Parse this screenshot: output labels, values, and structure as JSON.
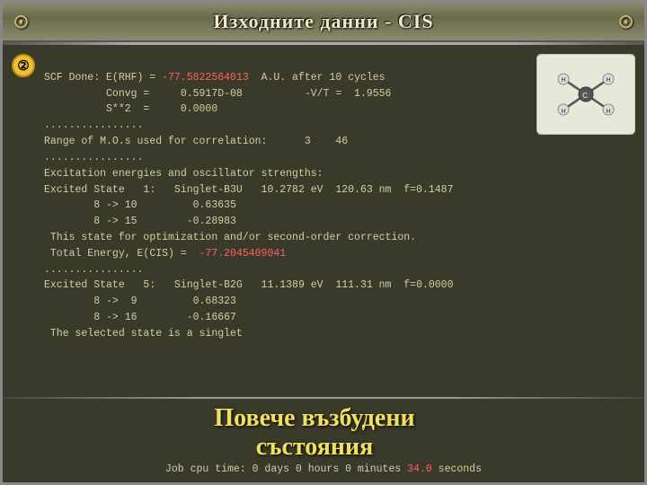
{
  "title": "Изходните данни - CIS",
  "badge": "②",
  "ornament_left": "⊙",
  "ornament_right": "⊙",
  "code_lines": [
    {
      "id": "line1",
      "text": "SCF Done: E(RHF) = ",
      "plain": true
    },
    {
      "id": "line1h",
      "text": "-77.5822564013",
      "highlight": true
    },
    {
      "id": "line1b",
      "text": "  A.U. after 10 cycles",
      "plain": true
    },
    {
      "id": "line2",
      "text": "          Convg =     0.5917D-08          -V/T =  1.9556",
      "plain": true
    },
    {
      "id": "line3",
      "text": "          S**2  =     0.0000",
      "plain": true
    },
    {
      "id": "dots1",
      "text": "................",
      "plain": true
    },
    {
      "id": "line4",
      "text": "Range of M.O.s used for correlation:      3    46",
      "plain": true
    },
    {
      "id": "dots2",
      "text": "................",
      "plain": true
    },
    {
      "id": "line5",
      "text": "Excitation energies and oscillator strengths:",
      "plain": true
    },
    {
      "id": "line6",
      "text": "Excited State   1:   Singlet-B3U   10.2782 eV  120.63 nm  f=0.1487",
      "plain": true
    },
    {
      "id": "line7",
      "text": "        8 -> 10         0.63635",
      "plain": true
    },
    {
      "id": "line8",
      "text": "        8 -> 15        -0.28983",
      "plain": true
    },
    {
      "id": "line9",
      "text": " This state for optimization and/or second-order correction.",
      "plain": true
    },
    {
      "id": "line10",
      "text": " Total Energy, E(CIS) =  ",
      "plain": true
    },
    {
      "id": "line10h",
      "text": "-77.2045409041",
      "highlight": true
    },
    {
      "id": "dots3",
      "text": "................",
      "plain": true
    },
    {
      "id": "line11",
      "text": "Excited State   5:   Singlet-B2G   11.1389 eV  111.31 nm  f=0.0000",
      "plain": true
    },
    {
      "id": "line12",
      "text": "        8 ->  9         0.68323",
      "plain": true
    },
    {
      "id": "line13",
      "text": "        8 -> 16        -0.16667",
      "plain": true
    },
    {
      "id": "line14",
      "text": " The selected state is a singlet",
      "plain": true
    }
  ],
  "big_text_line1": "Повече       възбудени",
  "big_text_line2": "състояния",
  "job_line": {
    "prefix": "Job cpu time:    0 days  0 hours  0 minutes ",
    "highlight": "34.0",
    "suffix": " seconds"
  }
}
